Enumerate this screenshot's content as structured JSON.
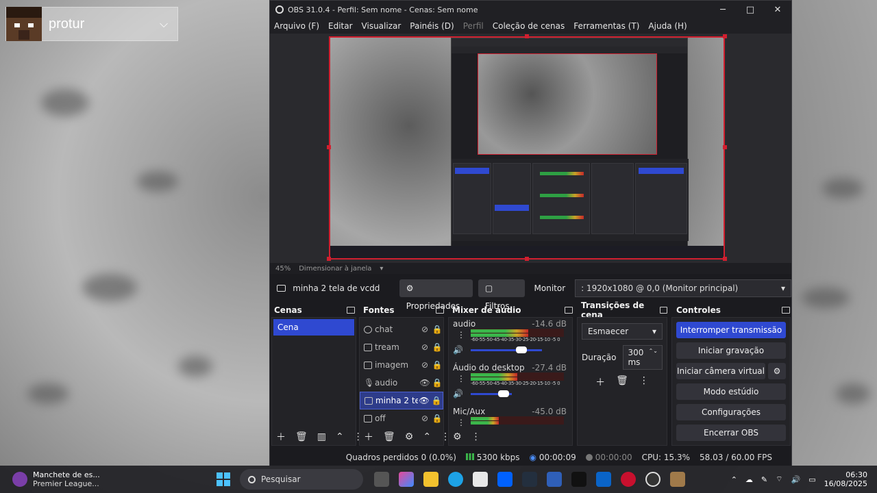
{
  "profile": {
    "name": "protur"
  },
  "window": {
    "title": "OBS 31.0.4 - Perfil: Sem nome - Cenas: Sem nome",
    "controls": {
      "minimize": "─",
      "maximize": "□",
      "close": "✕"
    }
  },
  "menu": {
    "items": [
      {
        "label": "Arquivo (F)",
        "disabled": false
      },
      {
        "label": "Editar",
        "disabled": false
      },
      {
        "label": "Visualizar",
        "disabled": false
      },
      {
        "label": "Painéis (D)",
        "disabled": false
      },
      {
        "label": "Perfil",
        "disabled": true
      },
      {
        "label": "Coleção de cenas",
        "disabled": false
      },
      {
        "label": "Ferramentas (T)",
        "disabled": false
      },
      {
        "label": "Ajuda (H)",
        "disabled": false
      }
    ]
  },
  "preview": {
    "zoom": "45%",
    "scale_mode": "Dimensionar à janela"
  },
  "source_toolbar": {
    "source_name": "minha 2 tela de vcdd",
    "properties": "Propriedades",
    "filters": "Filtros",
    "monitor_label": "Monitor",
    "monitor_value": ": 1920x1080 @ 0,0 (Monitor principal)"
  },
  "docks": {
    "scenes": {
      "title": "Cenas",
      "items": [
        "Cena"
      ]
    },
    "sources": {
      "title": "Fontes",
      "items": [
        {
          "label": "chat",
          "visible": false
        },
        {
          "label": "tream",
          "visible": false
        },
        {
          "label": "imagem",
          "visible": false
        },
        {
          "label": "audio",
          "visible": true
        },
        {
          "label": "minha 2 te",
          "visible": true,
          "selected": true
        },
        {
          "label": "off",
          "visible": false
        }
      ]
    },
    "mixer": {
      "title": "Mixer de áudio",
      "scale": "-60-55-50-45-40-35-30-25-20-15-10 -5  0",
      "tracks": [
        {
          "name": "audio",
          "db": "-14.6 dB",
          "level": 0.62
        },
        {
          "name": "Áudio do desktop",
          "db": "-27.4 dB",
          "level": 0.5
        },
        {
          "name": "Mic/Aux",
          "db": "-45.0 dB",
          "level": 0.3
        }
      ]
    },
    "transitions": {
      "title": "Transições de cena",
      "selected": "Esmaecer",
      "duration_label": "Duração",
      "duration_value": "300 ms"
    },
    "controls": {
      "title": "Controles",
      "buttons": [
        "Interromper transmissão",
        "Iniciar gravação",
        "Iniciar câmera virtual",
        "Modo estúdio",
        "Configurações",
        "Encerrar OBS"
      ]
    }
  },
  "status": {
    "dropped": "Quadros perdidos 0 (0.0%)",
    "bitrate": "5300 kbps",
    "stream_time": "00:00:09",
    "rec_time": "00:00:00",
    "cpu": "CPU: 15.3%",
    "fps": "58.03 / 60.00 FPS"
  },
  "taskbar": {
    "news_title": "Manchete de es...",
    "news_sub": "Premier League...",
    "search_placeholder": "Pesquisar",
    "time": "06:30",
    "date": "16/08/2025"
  },
  "colors": {
    "accent": "#2f49d1",
    "selection_border": "#d11f2f",
    "panel": "#232327"
  }
}
